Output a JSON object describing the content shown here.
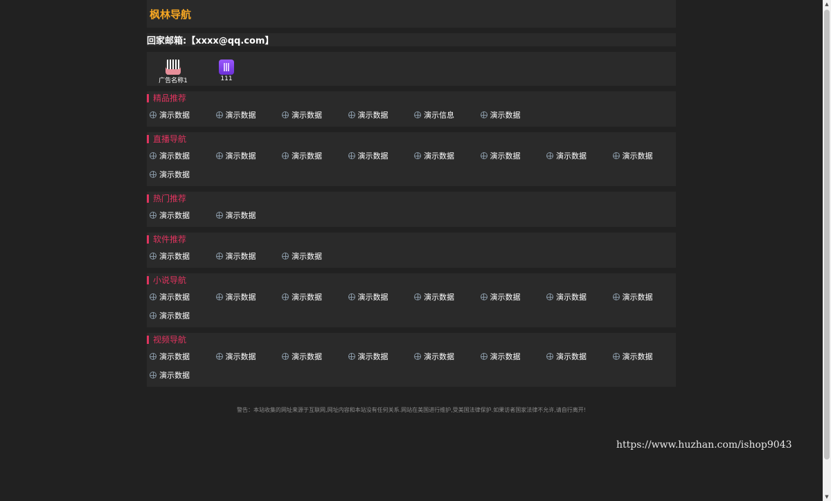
{
  "header": {
    "site_title": "枫林导航"
  },
  "email_bar": {
    "text": "回家邮箱:【xxxx@qq.com】"
  },
  "ads": [
    {
      "label": "广告名称1",
      "icon": "piano-ad-icon"
    },
    {
      "label": "111",
      "icon": "purple-ad-icon"
    }
  ],
  "sections": [
    {
      "title": "精品推荐",
      "links": [
        "演示数据",
        "演示数据",
        "演示数据",
        "演示数据",
        "演示信息",
        "演示数据"
      ]
    },
    {
      "title": "直播导航",
      "links": [
        "演示数据",
        "演示数据",
        "演示数据",
        "演示数据",
        "演示数据",
        "演示数据",
        "演示数据",
        "演示数据",
        "演示数据"
      ]
    },
    {
      "title": "热门推荐",
      "links": [
        "演示数据",
        "演示数据"
      ]
    },
    {
      "title": "软件推荐",
      "links": [
        "演示数据",
        "演示数据",
        "演示数据"
      ]
    },
    {
      "title": "小说导航",
      "links": [
        "演示数据",
        "演示数据",
        "演示数据",
        "演示数据",
        "演示数据",
        "演示数据",
        "演示数据",
        "演示数据",
        "演示数据"
      ]
    },
    {
      "title": "视频导航",
      "links": [
        "演示数据",
        "演示数据",
        "演示数据",
        "演示数据",
        "演示数据",
        "演示数据",
        "演示数据",
        "演示数据",
        "演示数据"
      ]
    }
  ],
  "footer": {
    "warning": "警告：本站收集的网址来源于互联网,网址内容和本站没有任何关系.网站在美国进行维护,受美国法律保护.如果访者国家法律不允许,请自行离开!"
  },
  "watermark": {
    "text": "https://www.huzhan.com/ishop9043"
  },
  "colors": {
    "accent": "#e0345f",
    "title": "#f5a623",
    "background": "#212121",
    "panel": "#2a2a2a"
  }
}
